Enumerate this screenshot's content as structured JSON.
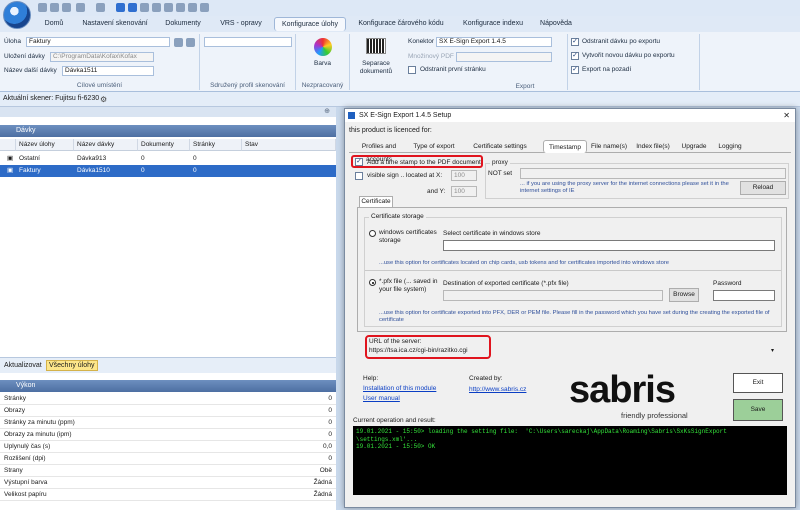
{
  "app": {
    "tabs": [
      "Domů",
      "Nastavení skenování",
      "Dokumenty",
      "VRS - opravy",
      "Konfigurace úlohy",
      "Konfigurace čárového kódu",
      "Konfigurace indexu",
      "Nápověda"
    ]
  },
  "ribbon": {
    "uloha_label": "Úloha",
    "uloha_value": "Faktury",
    "ulozeni_label": "Uložení dávky",
    "ulozeni_value": "C:\\ProgramData\\Kofax\\Kofax",
    "nazev_label": "Název další dávky",
    "nazev_value": "Dávka1511",
    "group1": "Cílové umístění",
    "group2": "Sdružený profil skenování",
    "barva": "Barva",
    "group3": "Nezpracovaný",
    "separace": "Separace dokumentů",
    "konektor_label": "Konektor",
    "konektor_value": "SX E-Sign Export 1.4.5",
    "mnozinovy_label": "Množinový PDF",
    "odstranit_prvni": "Odstranit první stránku",
    "odstranit_davku": "Odstranit dávku po exportu",
    "vytvorit": "Vytvořit novou dávku po exportu",
    "export_pozadi": "Export na pozadí",
    "group_export": "Export"
  },
  "status": {
    "scanner": "Aktuální skener: Fujitsu fi-6230"
  },
  "batches": {
    "title": "Dávky",
    "headers": [
      "Název úlohy",
      "Název dávky",
      "Dokumenty",
      "Stránky",
      "Stav"
    ],
    "rows": [
      [
        "Ostatní",
        "Dávka913",
        "0",
        "0",
        ""
      ],
      [
        "Faktury",
        "Dávka1510",
        "0",
        "0",
        ""
      ]
    ],
    "buttons": [
      "Aktualizovat",
      "Všechny úlohy"
    ]
  },
  "perf": {
    "title": "Výkon",
    "rows": [
      [
        "Stránky",
        "0"
      ],
      [
        "Obrazy",
        "0"
      ],
      [
        "Stránky za minutu (ppm)",
        "0"
      ],
      [
        "Obrazy za minutu (ipm)",
        "0"
      ],
      [
        "Uplynulý čas (s)",
        "0,0"
      ],
      [
        "Rozlišení (dpi)",
        "0"
      ],
      [
        "Strany",
        "Obě"
      ],
      [
        "Výstupní barva",
        "Žádná"
      ],
      [
        "Velikost papíru",
        "Žádná"
      ]
    ]
  },
  "dialog": {
    "title": "SX E-Sign Export 1.4.5 Setup",
    "licensed": "this product is licenced for:",
    "tabs": [
      "Profiles and accounts",
      "Type of export",
      "Certificate settings",
      "Timestamp",
      "File name(s)",
      "Index file(s)",
      "Upgrade",
      "Logging"
    ],
    "add_timestamp": "Add a time stamp to the PDF document",
    "visible_sign": "visible sign .. located at X:",
    "x_val": "100",
    "and_y": "and Y:",
    "y_val": "100",
    "proxy": "proxy",
    "not_set": "NOT set",
    "proxy_note": "... if you are using the proxy server for the internet connections please set it in the internet settings of IE",
    "reload": "Reload",
    "certificate_btn": "Certificate",
    "cert_storage": "Certificate storage",
    "windows_store": "windows certificates storage",
    "select_cert": "Select certificate in windows store",
    "windows_note": "...use this option for certificates located on chip cards, usb tokens and for certificates imported into windows store",
    "pfx_file": "*.pfx file (... saved in your file system)",
    "dest_pfx": "Destination of exported certificate (*.pfx file)",
    "password": "Password",
    "browse": "Browse",
    "pfx_note": "...use this option for certificate exported into PFX, DER or PEM file. Please fill in the password which you have set during the creating the exported file of certificate",
    "url_label": "URL of the server:",
    "url_value": "https://tsa.ica.cz/cgi-bin/razitko.cgi",
    "help": "Help:",
    "install": "Installation of this module",
    "manual": "User manual",
    "created_by": "Created by:",
    "sabris_url": "http://www.sabris.cz",
    "brand": "sabris",
    "tagline": "friendly professional",
    "exit": "Exit",
    "save": "Save",
    "current_op": "Current operation and result:",
    "console": "19.01.2021 - 15:50> loading the setting file:  'C:\\Users\\sareckaj\\AppData\\Roaming\\Sabris\\SxKsSignExport\n\\settings.xml'...\n19.01.2021 - 15:50> OK"
  }
}
